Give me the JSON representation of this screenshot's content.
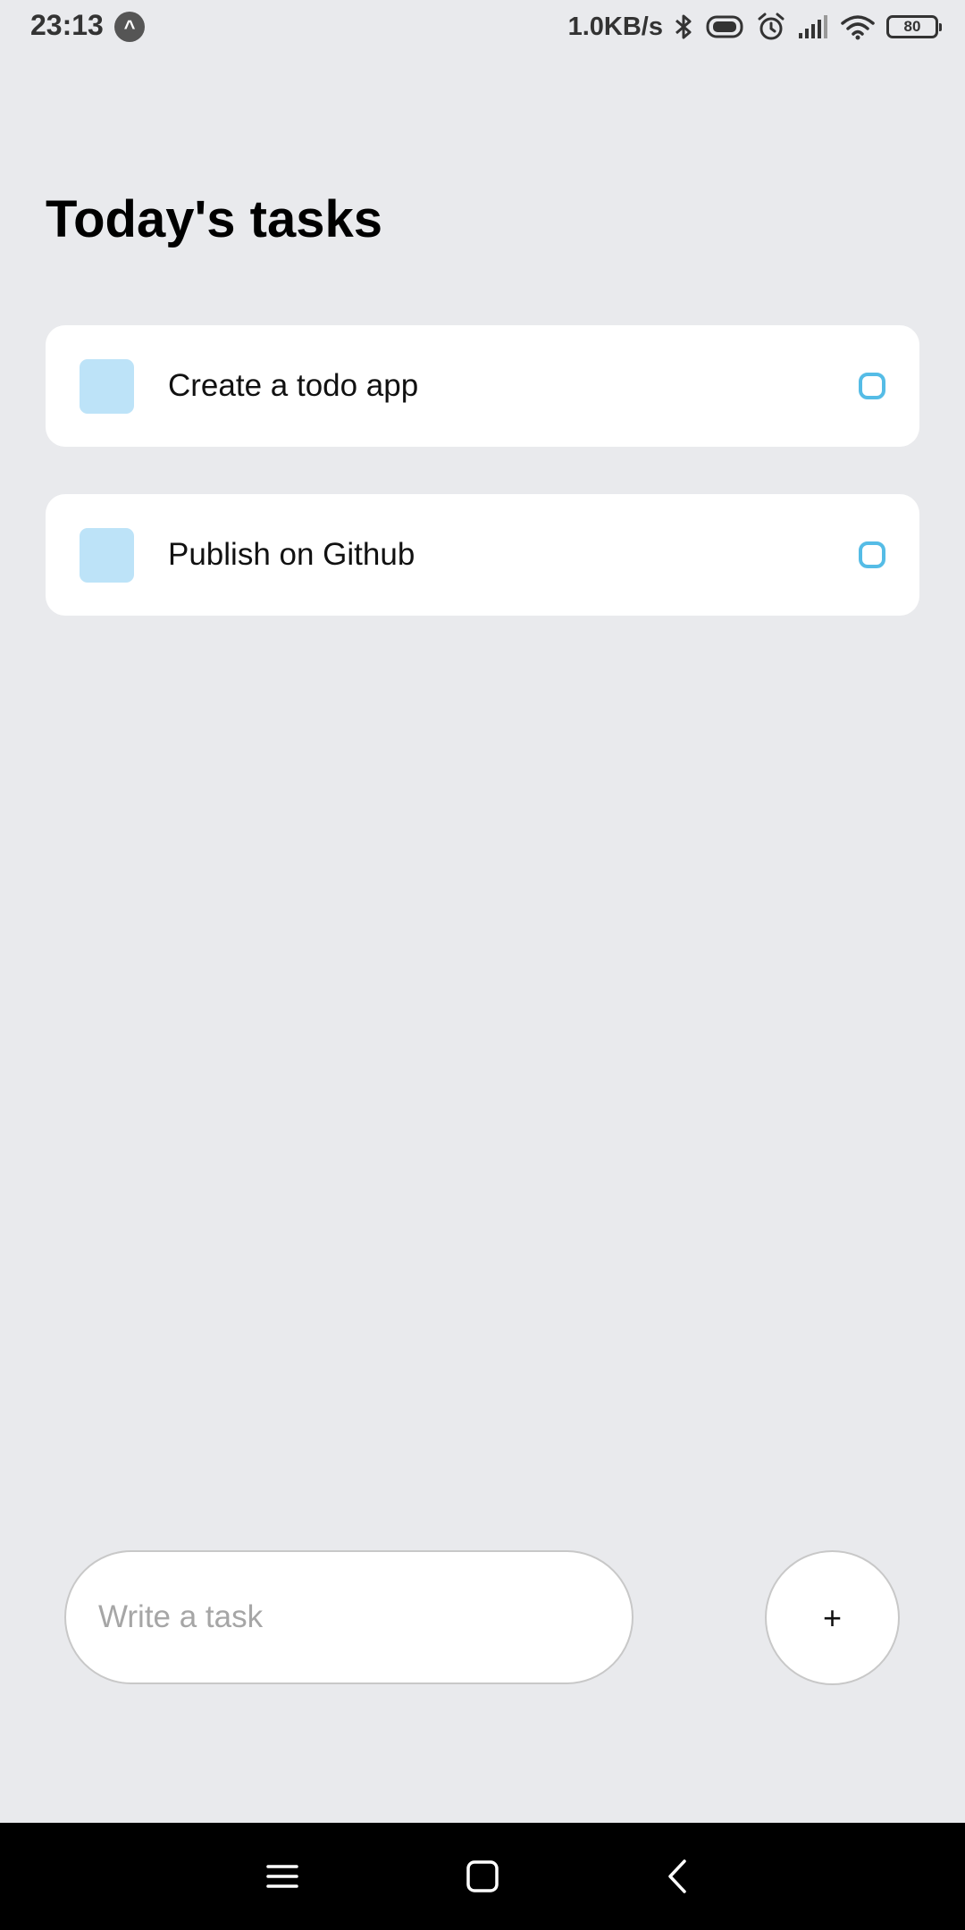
{
  "status_bar": {
    "time": "23:13",
    "app_icon_glyph": "^",
    "net_speed": "1.0KB/s",
    "battery_level": "80",
    "icons": [
      "bluetooth-icon",
      "vibrate-icon",
      "alarm-icon",
      "signal-icon",
      "wifi-icon",
      "battery-icon"
    ]
  },
  "header": {
    "title": "Today's tasks"
  },
  "tasks": [
    {
      "label": "Create a todo app",
      "completed": false
    },
    {
      "label": "Publish on Github",
      "completed": false
    }
  ],
  "composer": {
    "placeholder": "Write a task",
    "value": "",
    "add_label": "+"
  },
  "nav_bar": {
    "buttons": [
      "menu-icon",
      "home-icon",
      "back-icon"
    ]
  },
  "colors": {
    "background": "#e9eaed",
    "card": "#ffffff",
    "task_square": "#bde3f8",
    "task_circle": "#55bce6"
  }
}
